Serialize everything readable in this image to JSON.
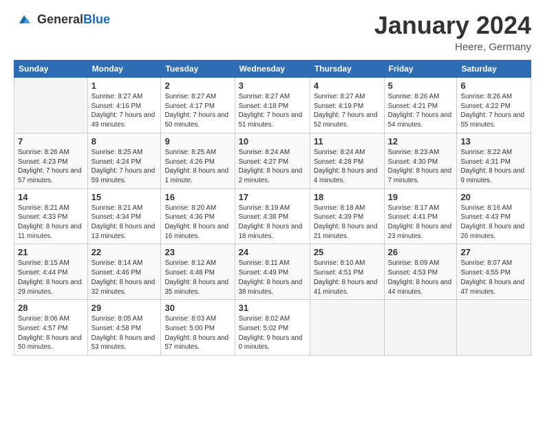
{
  "logo": {
    "general": "General",
    "blue": "Blue"
  },
  "title": "January 2024",
  "location": "Heere, Germany",
  "days_of_week": [
    "Sunday",
    "Monday",
    "Tuesday",
    "Wednesday",
    "Thursday",
    "Friday",
    "Saturday"
  ],
  "weeks": [
    [
      {
        "day": "",
        "empty": true
      },
      {
        "day": "1",
        "sunrise": "Sunrise: 8:27 AM",
        "sunset": "Sunset: 4:16 PM",
        "daylight": "Daylight: 7 hours and 49 minutes."
      },
      {
        "day": "2",
        "sunrise": "Sunrise: 8:27 AM",
        "sunset": "Sunset: 4:17 PM",
        "daylight": "Daylight: 7 hours and 50 minutes."
      },
      {
        "day": "3",
        "sunrise": "Sunrise: 8:27 AM",
        "sunset": "Sunset: 4:18 PM",
        "daylight": "Daylight: 7 hours and 51 minutes."
      },
      {
        "day": "4",
        "sunrise": "Sunrise: 8:27 AM",
        "sunset": "Sunset: 4:19 PM",
        "daylight": "Daylight: 7 hours and 52 minutes."
      },
      {
        "day": "5",
        "sunrise": "Sunrise: 8:26 AM",
        "sunset": "Sunset: 4:21 PM",
        "daylight": "Daylight: 7 hours and 54 minutes."
      },
      {
        "day": "6",
        "sunrise": "Sunrise: 8:26 AM",
        "sunset": "Sunset: 4:22 PM",
        "daylight": "Daylight: 7 hours and 55 minutes."
      }
    ],
    [
      {
        "day": "7",
        "sunrise": "Sunrise: 8:26 AM",
        "sunset": "Sunset: 4:23 PM",
        "daylight": "Daylight: 7 hours and 57 minutes."
      },
      {
        "day": "8",
        "sunrise": "Sunrise: 8:25 AM",
        "sunset": "Sunset: 4:24 PM",
        "daylight": "Daylight: 7 hours and 59 minutes."
      },
      {
        "day": "9",
        "sunrise": "Sunrise: 8:25 AM",
        "sunset": "Sunset: 4:26 PM",
        "daylight": "Daylight: 8 hours and 1 minute."
      },
      {
        "day": "10",
        "sunrise": "Sunrise: 8:24 AM",
        "sunset": "Sunset: 4:27 PM",
        "daylight": "Daylight: 8 hours and 2 minutes."
      },
      {
        "day": "11",
        "sunrise": "Sunrise: 8:24 AM",
        "sunset": "Sunset: 4:28 PM",
        "daylight": "Daylight: 8 hours and 4 minutes."
      },
      {
        "day": "12",
        "sunrise": "Sunrise: 8:23 AM",
        "sunset": "Sunset: 4:30 PM",
        "daylight": "Daylight: 8 hours and 7 minutes."
      },
      {
        "day": "13",
        "sunrise": "Sunrise: 8:22 AM",
        "sunset": "Sunset: 4:31 PM",
        "daylight": "Daylight: 8 hours and 9 minutes."
      }
    ],
    [
      {
        "day": "14",
        "sunrise": "Sunrise: 8:21 AM",
        "sunset": "Sunset: 4:33 PM",
        "daylight": "Daylight: 8 hours and 11 minutes."
      },
      {
        "day": "15",
        "sunrise": "Sunrise: 8:21 AM",
        "sunset": "Sunset: 4:34 PM",
        "daylight": "Daylight: 8 hours and 13 minutes."
      },
      {
        "day": "16",
        "sunrise": "Sunrise: 8:20 AM",
        "sunset": "Sunset: 4:36 PM",
        "daylight": "Daylight: 8 hours and 16 minutes."
      },
      {
        "day": "17",
        "sunrise": "Sunrise: 8:19 AM",
        "sunset": "Sunset: 4:38 PM",
        "daylight": "Daylight: 8 hours and 18 minutes."
      },
      {
        "day": "18",
        "sunrise": "Sunrise: 8:18 AM",
        "sunset": "Sunset: 4:39 PM",
        "daylight": "Daylight: 8 hours and 21 minutes."
      },
      {
        "day": "19",
        "sunrise": "Sunrise: 8:17 AM",
        "sunset": "Sunset: 4:41 PM",
        "daylight": "Daylight: 8 hours and 23 minutes."
      },
      {
        "day": "20",
        "sunrise": "Sunrise: 8:16 AM",
        "sunset": "Sunset: 4:43 PM",
        "daylight": "Daylight: 8 hours and 26 minutes."
      }
    ],
    [
      {
        "day": "21",
        "sunrise": "Sunrise: 8:15 AM",
        "sunset": "Sunset: 4:44 PM",
        "daylight": "Daylight: 8 hours and 29 minutes."
      },
      {
        "day": "22",
        "sunrise": "Sunrise: 8:14 AM",
        "sunset": "Sunset: 4:46 PM",
        "daylight": "Daylight: 8 hours and 32 minutes."
      },
      {
        "day": "23",
        "sunrise": "Sunrise: 8:12 AM",
        "sunset": "Sunset: 4:48 PM",
        "daylight": "Daylight: 8 hours and 35 minutes."
      },
      {
        "day": "24",
        "sunrise": "Sunrise: 8:11 AM",
        "sunset": "Sunset: 4:49 PM",
        "daylight": "Daylight: 8 hours and 38 minutes."
      },
      {
        "day": "25",
        "sunrise": "Sunrise: 8:10 AM",
        "sunset": "Sunset: 4:51 PM",
        "daylight": "Daylight: 8 hours and 41 minutes."
      },
      {
        "day": "26",
        "sunrise": "Sunrise: 8:09 AM",
        "sunset": "Sunset: 4:53 PM",
        "daylight": "Daylight: 8 hours and 44 minutes."
      },
      {
        "day": "27",
        "sunrise": "Sunrise: 8:07 AM",
        "sunset": "Sunset: 4:55 PM",
        "daylight": "Daylight: 8 hours and 47 minutes."
      }
    ],
    [
      {
        "day": "28",
        "sunrise": "Sunrise: 8:06 AM",
        "sunset": "Sunset: 4:57 PM",
        "daylight": "Daylight: 8 hours and 50 minutes."
      },
      {
        "day": "29",
        "sunrise": "Sunrise: 8:05 AM",
        "sunset": "Sunset: 4:58 PM",
        "daylight": "Daylight: 8 hours and 53 minutes."
      },
      {
        "day": "30",
        "sunrise": "Sunrise: 8:03 AM",
        "sunset": "Sunset: 5:00 PM",
        "daylight": "Daylight: 8 hours and 57 minutes."
      },
      {
        "day": "31",
        "sunrise": "Sunrise: 8:02 AM",
        "sunset": "Sunset: 5:02 PM",
        "daylight": "Daylight: 9 hours and 0 minutes."
      },
      {
        "day": "",
        "empty": true
      },
      {
        "day": "",
        "empty": true
      },
      {
        "day": "",
        "empty": true
      }
    ]
  ]
}
